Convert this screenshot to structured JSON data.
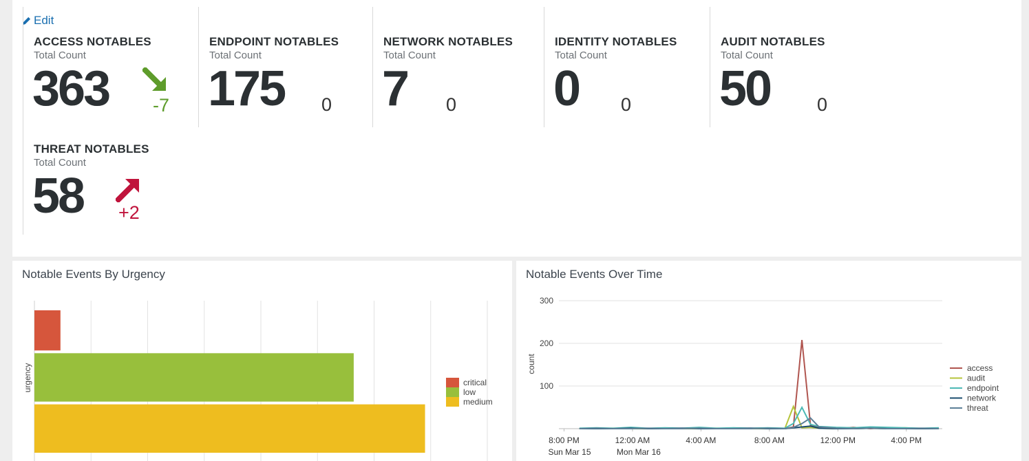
{
  "edit_label": "Edit",
  "kpis": [
    {
      "title": "ACCESS NOTABLES",
      "subtitle": "Total Count",
      "value": "363",
      "delta": "-7",
      "trend": "down"
    },
    {
      "title": "ENDPOINT NOTABLES",
      "subtitle": "Total Count",
      "value": "175",
      "delta": "0",
      "trend": "none"
    },
    {
      "title": "NETWORK NOTABLES",
      "subtitle": "Total Count",
      "value": "7",
      "delta": "0",
      "trend": "none"
    },
    {
      "title": "IDENTITY NOTABLES",
      "subtitle": "Total Count",
      "value": "0",
      "delta": "0",
      "trend": "none"
    },
    {
      "title": "AUDIT NOTABLES",
      "subtitle": "Total Count",
      "value": "50",
      "delta": "0",
      "trend": "none"
    },
    {
      "title": "THREAT NOTABLES",
      "subtitle": "Total Count",
      "value": "58",
      "delta": "+2",
      "trend": "up"
    }
  ],
  "colors": {
    "trend_down": "#5e9c2b",
    "trend_up": "#c0143c",
    "critical": "#d6563c",
    "low": "#98bf3c",
    "medium": "#eebd1f",
    "access": "#b0554f",
    "audit": "#b5c43b",
    "endpoint": "#4cb8b4",
    "network": "#1a4c6e",
    "threat": "#5c7f97"
  },
  "chart_data": [
    {
      "type": "bar",
      "title": "Notable Events By Urgency",
      "orientation": "horizontal",
      "ylabel": "urgency",
      "categories": [
        "critical",
        "low",
        "medium"
      ],
      "values": [
        23,
        282,
        345
      ],
      "xlim": [
        0,
        400
      ],
      "grid": true,
      "legend": [
        "critical",
        "low",
        "medium"
      ],
      "legend_position": "right"
    },
    {
      "type": "line",
      "title": "Notable Events Over Time",
      "ylabel": "count",
      "ylim": [
        0,
        300
      ],
      "yticks": [
        100,
        200,
        300
      ],
      "xticks": [
        {
          "label": "8:00 PM",
          "sublabel": "Sun Mar 15"
        },
        {
          "label": "12:00 AM",
          "sublabel": "Mon Mar 16"
        },
        {
          "label": "4:00 AM",
          "sublabel": ""
        },
        {
          "label": "8:00 AM",
          "sublabel": ""
        },
        {
          "label": "12:00 PM",
          "sublabel": ""
        },
        {
          "label": "4:00 PM",
          "sublabel": ""
        }
      ],
      "x_hours": [
        -1,
        0,
        1,
        2,
        3,
        4,
        5,
        6,
        7,
        8,
        9,
        10,
        11,
        11.5,
        12,
        12.5,
        13,
        14,
        15,
        16,
        17,
        18,
        19,
        20
      ],
      "grid": true,
      "legend_position": "right",
      "series": [
        {
          "name": "access",
          "values": [
            0,
            1,
            0,
            2,
            0,
            1,
            0,
            2,
            0,
            1,
            0,
            1,
            0,
            4,
            208,
            8,
            2,
            0,
            3,
            0,
            2,
            1,
            0,
            1
          ]
        },
        {
          "name": "audit",
          "values": [
            0,
            0,
            1,
            0,
            0,
            1,
            0,
            0,
            1,
            0,
            0,
            0,
            0,
            52,
            2,
            3,
            1,
            0,
            0,
            1,
            0,
            2,
            0,
            0
          ]
        },
        {
          "name": "endpoint",
          "values": [
            1,
            2,
            1,
            3,
            1,
            2,
            1,
            3,
            1,
            2,
            1,
            2,
            1,
            12,
            50,
            10,
            5,
            3,
            2,
            4,
            3,
            2,
            1,
            2
          ]
        },
        {
          "name": "network",
          "values": [
            0,
            0,
            0,
            1,
            0,
            0,
            1,
            0,
            0,
            0,
            1,
            0,
            0,
            2,
            4,
            6,
            1,
            0,
            0,
            1,
            0,
            0,
            0,
            0
          ]
        },
        {
          "name": "threat",
          "values": [
            0,
            1,
            0,
            0,
            1,
            0,
            0,
            1,
            0,
            0,
            0,
            1,
            0,
            3,
            12,
            25,
            4,
            1,
            0,
            1,
            0,
            0,
            1,
            0
          ]
        }
      ]
    }
  ]
}
